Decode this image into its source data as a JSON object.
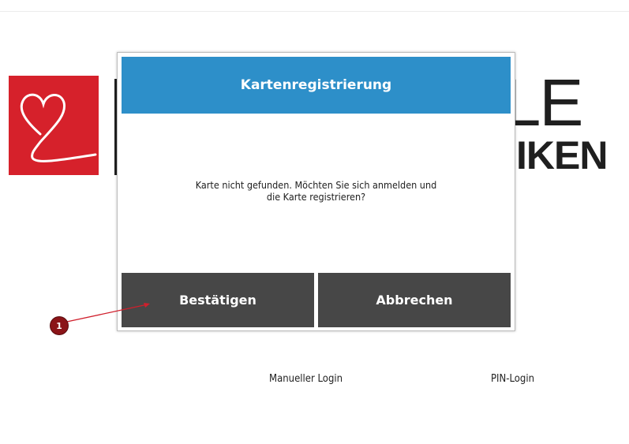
{
  "background_logo": {
    "wordmark_top": "ULE",
    "wordmark_bottom": "IKEN",
    "mark_color": "#d6212b",
    "icon": "heart-icon"
  },
  "dialog": {
    "title": "Kartenregistrierung",
    "message_line1": "Karte nicht gefunden. Möchten Sie sich anmelden und",
    "message_line2": "die Karte registrieren?",
    "confirm_label": "Bestätigen",
    "cancel_label": "Abbrechen",
    "header_color": "#2d8fc9",
    "button_color": "#474747"
  },
  "annotation": {
    "badge_label": "1",
    "color": "#8b1418"
  },
  "links": {
    "manual_login": "Manueller Login",
    "pin_login": "PIN-Login"
  }
}
